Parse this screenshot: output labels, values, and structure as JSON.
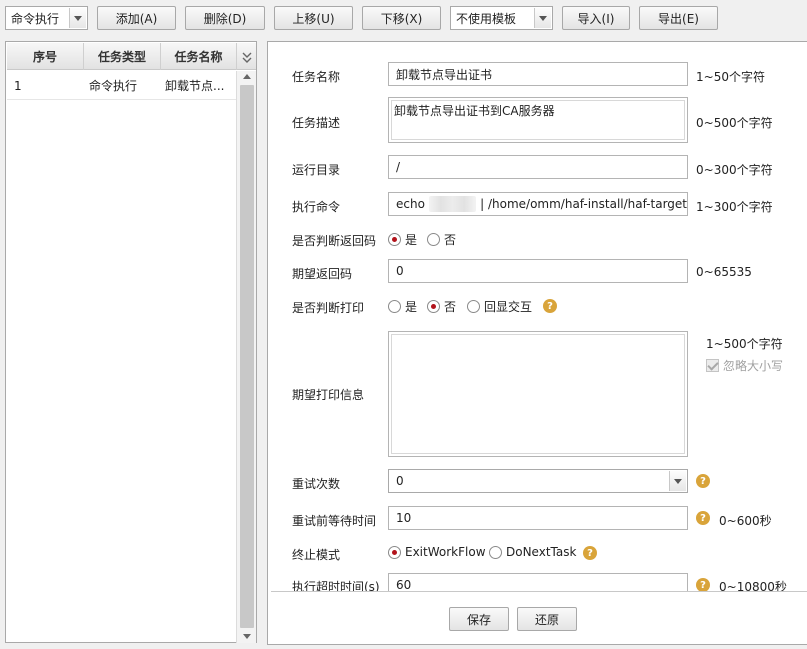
{
  "toolbar": {
    "task_type_select": "命令执行",
    "add": "添加(A)",
    "delete": "删除(D)",
    "move_up": "上移(U)",
    "move_down": "下移(X)",
    "template_select": "不使用模板",
    "import": "导入(I)",
    "export": "导出(E)"
  },
  "task_list": {
    "columns": [
      "序号",
      "任务类型",
      "任务名称"
    ],
    "rows": [
      {
        "index": "1",
        "type": "命令执行",
        "name": "卸载节点..."
      }
    ]
  },
  "form": {
    "task_name": {
      "label": "任务名称",
      "value": "卸载节点导出证书",
      "hint": "1~50个字符"
    },
    "task_desc": {
      "label": "任务描述",
      "value": "卸载节点导出证书到CA服务器",
      "hint": "0~500个字符"
    },
    "run_dir": {
      "label": "运行目录",
      "value": "/",
      "hint": "0~300个字符"
    },
    "exec_cmd": {
      "label": "执行命令",
      "value_prefix": "echo",
      "value_suffix": "| /home/omm/haf-install/haf-target",
      "hint": "1~300个字符"
    },
    "check_return": {
      "label": "是否判断返回码",
      "opt_yes": "是",
      "opt_no": "否",
      "selected": "是"
    },
    "expected_return": {
      "label": "期望返回码",
      "value": "0",
      "hint": "0~65535"
    },
    "check_print": {
      "label": "是否判断打印",
      "opt_yes": "是",
      "opt_no": "否",
      "opt_echo": "回显交互",
      "selected": "否"
    },
    "expected_print": {
      "label": "期望打印信息",
      "value": "",
      "hint": "1~500个字符",
      "ignore_case": "忽略大小写"
    },
    "retry_count": {
      "label": "重试次数",
      "value": "0"
    },
    "retry_wait": {
      "label": "重试前等待时间",
      "value": "10",
      "hint": "0~600秒"
    },
    "stop_mode": {
      "label": "终止模式",
      "opt_exit": "ExitWorkFlow",
      "opt_next": "DoNextTask",
      "selected": "ExitWorkFlow"
    },
    "timeout": {
      "label": "执行超时时间(s)",
      "value": "60",
      "hint": "0~10800秒"
    }
  },
  "footer": {
    "save": "保存",
    "reset": "还原"
  },
  "colors": {
    "radio_dot": "#b2131b",
    "help_icon": "#d9a43a"
  }
}
